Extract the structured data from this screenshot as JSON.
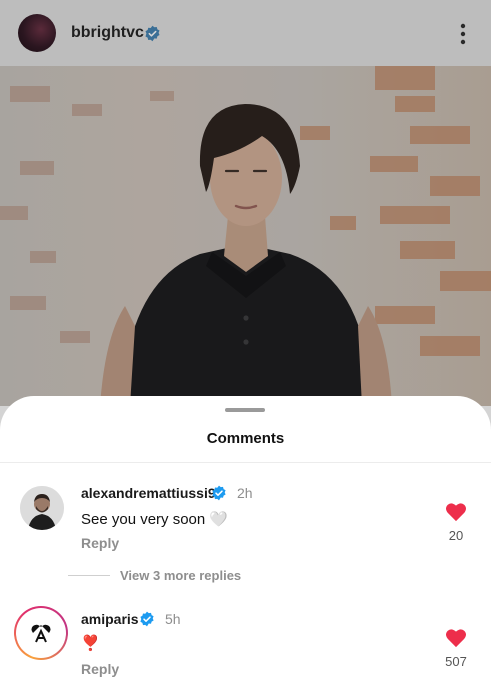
{
  "header": {
    "username": "bbrightvc"
  },
  "sheet": {
    "title": "Comments",
    "view_more": "View 3 more replies"
  },
  "comments": [
    {
      "username": "alexandremattiussi9",
      "time": "2h",
      "text": "See you very soon 🤍",
      "reply": "Reply",
      "likes": "20"
    },
    {
      "username": "amiparis",
      "time": "5h",
      "text": "❣️",
      "reply": "Reply",
      "likes": "507"
    }
  ],
  "colors": {
    "verified": "#1d9bf0",
    "like": "#ed2e4b",
    "sheet_bg": "#ffffff"
  },
  "icons": [
    "verified-icon",
    "more-options-icon",
    "heart-icon"
  ]
}
